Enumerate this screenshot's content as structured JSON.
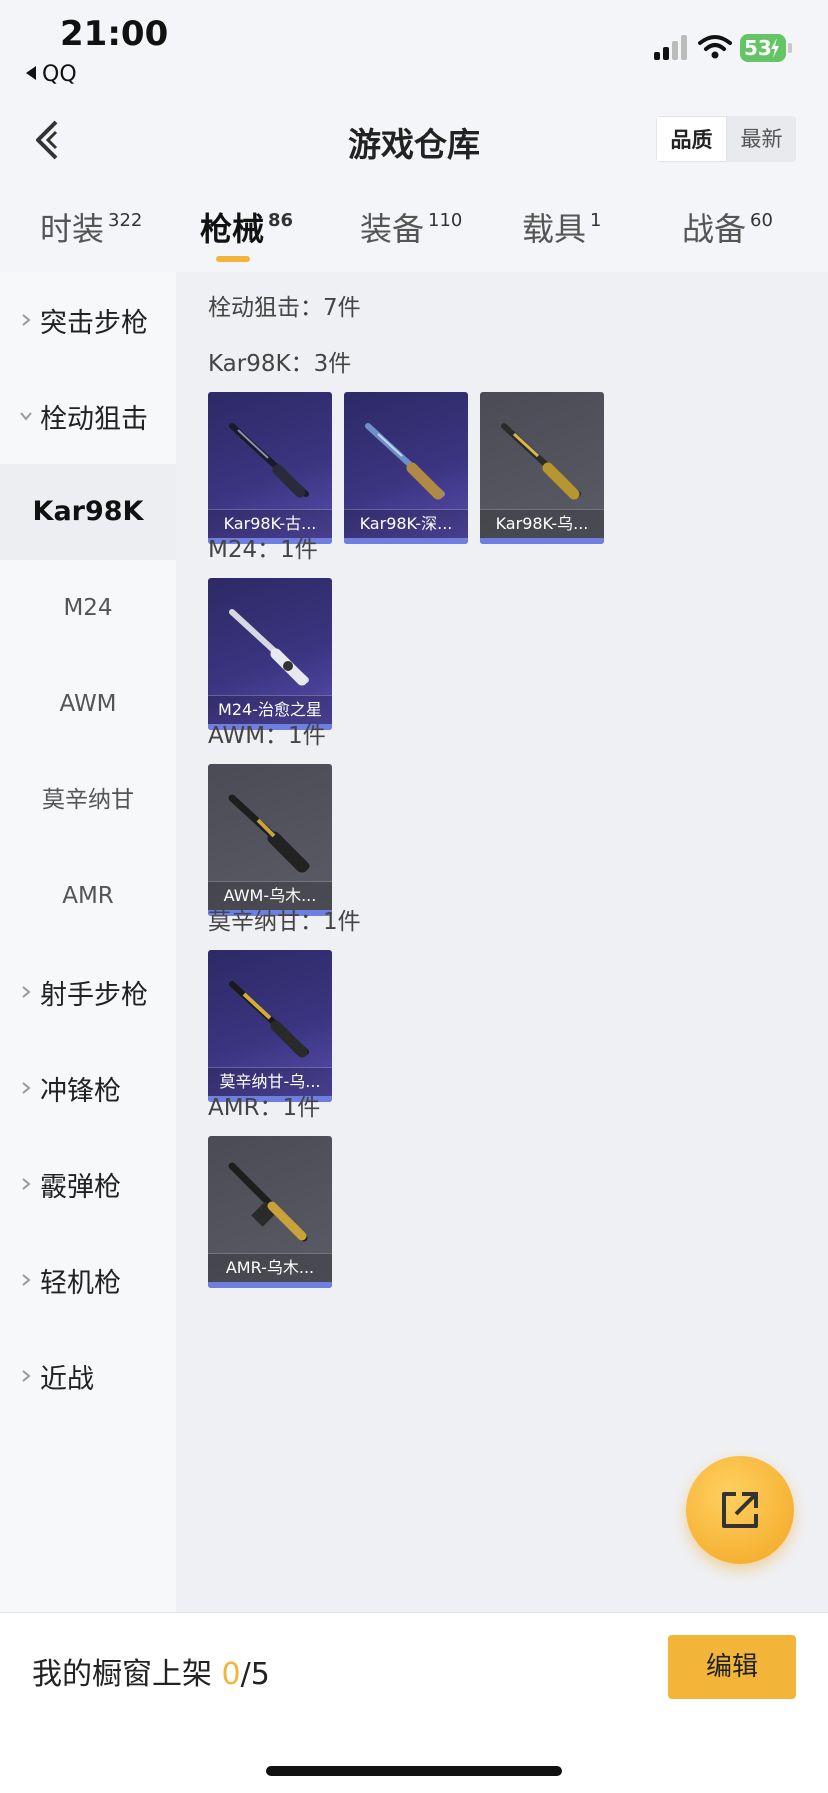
{
  "status_bar": {
    "time": "21:00",
    "back_app": "QQ",
    "battery": "53"
  },
  "header": {
    "title": "游戏仓库",
    "sort_options": [
      "品质",
      "最新"
    ]
  },
  "tabs": [
    {
      "label": "时装",
      "count": "322"
    },
    {
      "label": "枪械",
      "count": "86"
    },
    {
      "label": "装备",
      "count": "110"
    },
    {
      "label": "载具",
      "count": "1"
    },
    {
      "label": "战备",
      "count": "60"
    }
  ],
  "sidebar": {
    "groups": [
      "突击步枪",
      "栓动狙击",
      "射手步枪",
      "冲锋枪",
      "霰弹枪",
      "轻机枪",
      "近战"
    ],
    "subitems": [
      "Kar98K",
      "M24",
      "AWM",
      "莫辛纳甘",
      "AMR"
    ]
  },
  "content": {
    "summary": "栓动狙击：7件",
    "sections": [
      {
        "title": "Kar98K：3件",
        "items": [
          "Kar98K-古...",
          "Kar98K-深...",
          "Kar98K-乌..."
        ]
      },
      {
        "title": "M24：1件",
        "items": [
          "M24-治愈之星"
        ]
      },
      {
        "title": "AWM：1件",
        "items": [
          "AWM-乌木..."
        ]
      },
      {
        "title": "莫辛纳甘：1件",
        "items": [
          "莫辛纳甘-乌..."
        ]
      },
      {
        "title": "AMR：1件",
        "items": [
          "AMR-乌木..."
        ]
      }
    ]
  },
  "bottom": {
    "label": "我的橱窗上架 ",
    "current": "0",
    "total": "/5",
    "edit": "编辑"
  },
  "colors": {
    "accent": "#f2b53a",
    "purple_card": "#3b3480",
    "grey_card": "#55565f",
    "rarity_bar": "#6e7fe0"
  },
  "icons": [
    "back-chevron-icon",
    "share-icon",
    "chevron-right-icon",
    "chevron-down-icon",
    "signal-icon",
    "wifi-icon",
    "battery-icon"
  ]
}
